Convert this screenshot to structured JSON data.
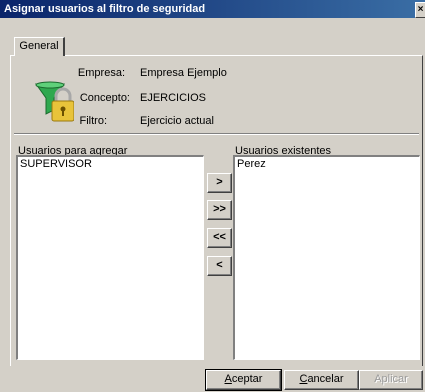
{
  "window": {
    "title": "Asignar usuarios al filtro de seguridad",
    "close_label": "×"
  },
  "tabs": [
    {
      "label": "General"
    }
  ],
  "info": {
    "empresa": {
      "label": "Empresa:",
      "value": "Empresa Ejemplo"
    },
    "concepto": {
      "label": "Concepto:",
      "value": "EJERCICIOS"
    },
    "filtro": {
      "label": "Filtro:",
      "value": "Ejercicio actual"
    }
  },
  "lists": {
    "left": {
      "label": "Usuarios para agregar",
      "items": [
        "SUPERVISOR"
      ]
    },
    "right": {
      "label": "Usuarios existentes",
      "items": [
        "Perez"
      ]
    }
  },
  "move_buttons": {
    "add": ">",
    "add_all": ">>",
    "remove_all": "<<",
    "remove": "<"
  },
  "buttons": {
    "accept": {
      "first": "A",
      "rest": "ceptar"
    },
    "cancel": {
      "first": "C",
      "rest": "ancelar"
    },
    "apply": {
      "label": "Aplicar"
    }
  },
  "icon": "lock-filter-icon"
}
